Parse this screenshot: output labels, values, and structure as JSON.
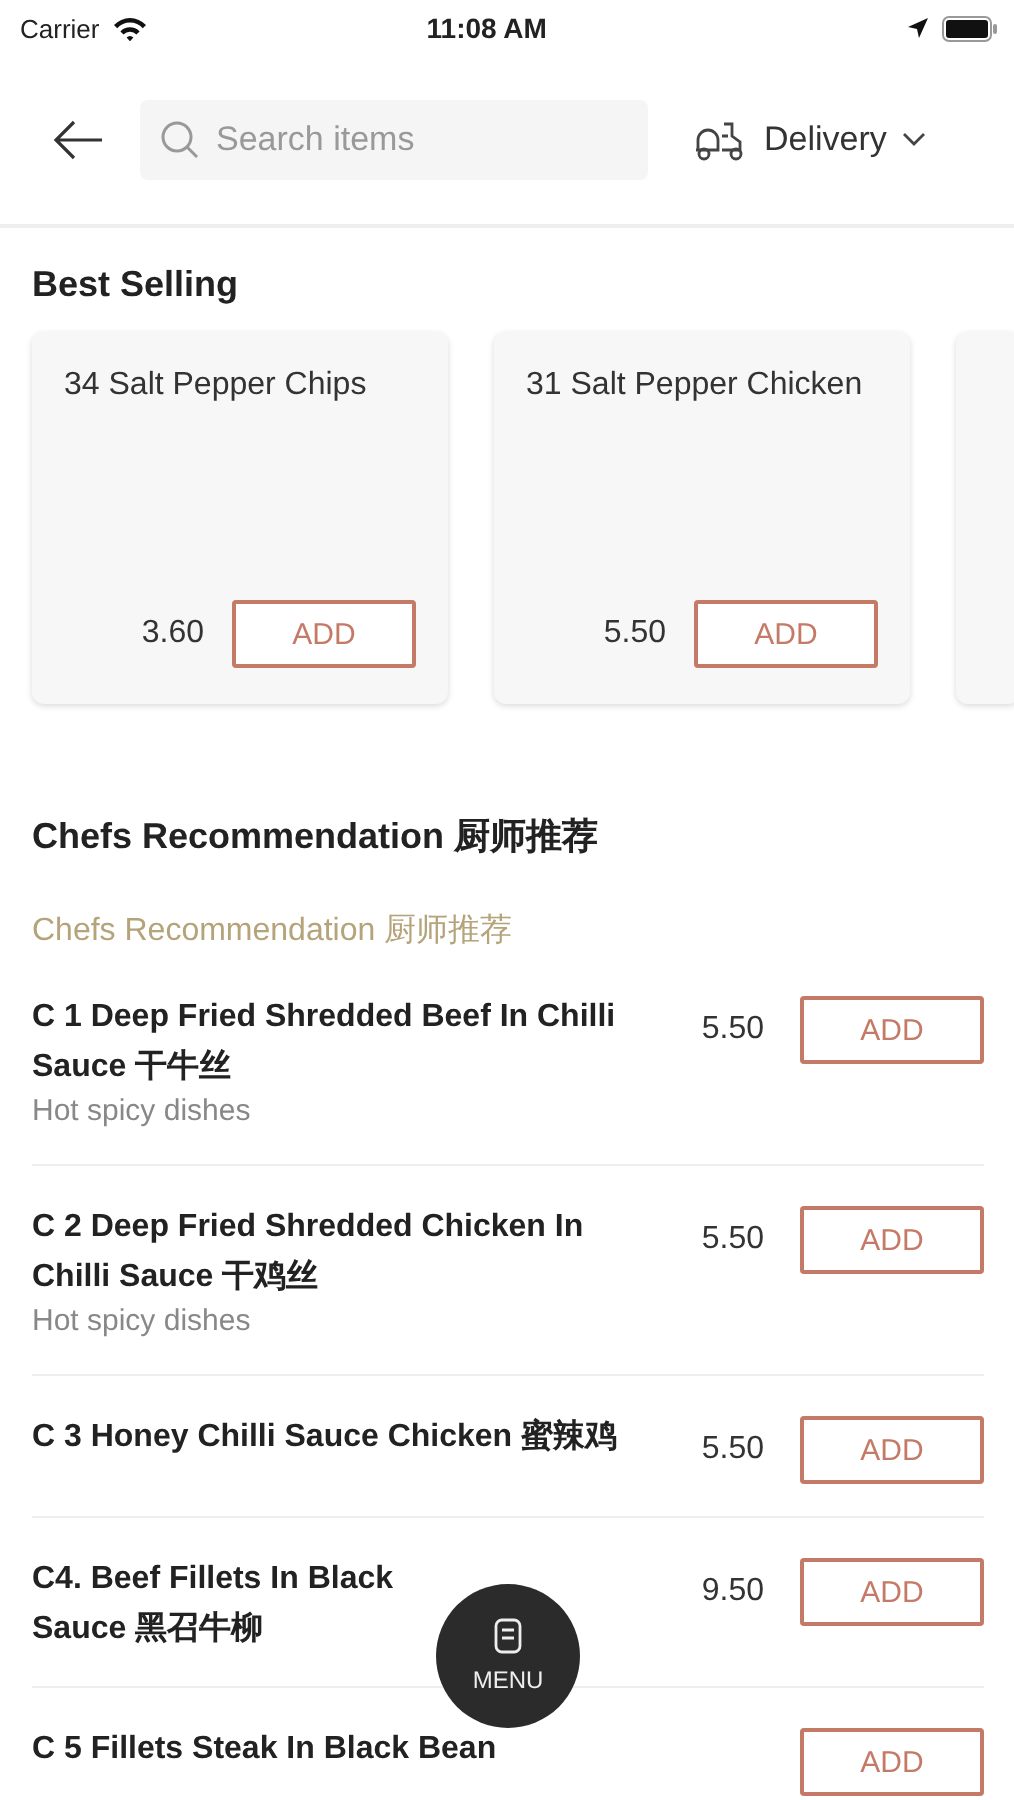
{
  "status_bar": {
    "carrier": "Carrier",
    "time": "11:08 AM"
  },
  "header": {
    "search": {
      "placeholder": "Search items"
    },
    "order_type": "Delivery"
  },
  "best_selling": {
    "title": "Best Selling",
    "items": [
      {
        "name": "34 Salt Pepper Chips",
        "price": "3.60",
        "button": "ADD"
      },
      {
        "name": "31 Salt Pepper Chicken",
        "price": "5.50",
        "button": "ADD"
      }
    ]
  },
  "category": {
    "title": "Chefs Recommendation 厨师推荐",
    "subtitle": "Chefs Recommendation 厨师推荐",
    "items": [
      {
        "name": "C 1 Deep Fried Shredded Beef In Chilli Sauce 干牛丝",
        "description": "Hot spicy dishes",
        "price": "5.50",
        "button": "ADD"
      },
      {
        "name": "C 2 Deep Fried Shredded Chicken In Chilli Sauce 干鸡丝",
        "description": "Hot spicy dishes",
        "price": "5.50",
        "button": "ADD"
      },
      {
        "name": "C 3 Honey Chilli Sauce Chicken 蜜辣鸡",
        "price": "5.50",
        "button": "ADD"
      },
      {
        "name_lines": [
          "C4. Beef Fillets In Black",
          "Sauce 黑召牛柳"
        ],
        "price": "9.50",
        "button": "ADD"
      },
      {
        "name": "C 5 Fillets Steak In Black Bean",
        "button": "ADD"
      }
    ]
  },
  "menu_button": "MENU"
}
